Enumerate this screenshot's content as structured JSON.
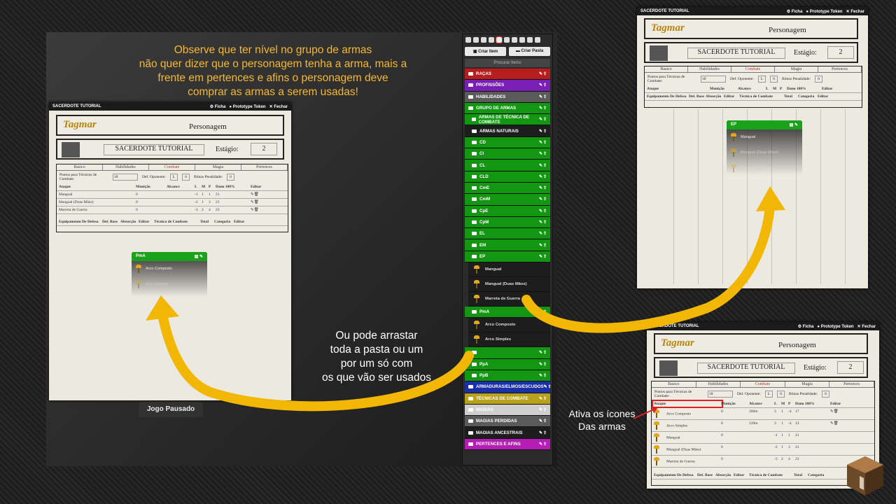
{
  "top_caption": [
    "Observe que ter nível no grupo de armas",
    "não quer dizer que o personagem tenha a arma, mais a",
    "frente em pertences e afins o personagem deve",
    "comprar as armas a serem usadas!"
  ],
  "mid_caption": [
    "Ou pode arrastar",
    "toda a pasta ou um",
    "por um só com",
    "os que vão ser usados"
  ],
  "right_caption": [
    "Ativa os ícones",
    "Das armas"
  ],
  "paused_label": "Jogo Pausado",
  "sheet": {
    "window_title": "SACERDOTE TUTORIAL",
    "ficha": "Ficha",
    "prototype": "Prototype Token",
    "fechar": "Fechar",
    "logo": "Tagmar",
    "title": "Personagem",
    "char_name": "SACERDOTE TUTORIAL",
    "estagio_label": "Estágio:",
    "estagio_value": "2",
    "tabs": [
      "Basico",
      "Habilidades",
      "Combate",
      "Magia",
      "Pertences"
    ],
    "pontos_label": "Pontos para Técnicas de Combate:",
    "pontos_value": "18",
    "def_label": "Def. Oponente:",
    "def_sel": "L",
    "def_val": "0",
    "bonus_label": "Bônus Penalidade:",
    "bonus_val": "0",
    "headers": [
      "Ataque",
      "Munição",
      "Alcance",
      "L",
      "M",
      "P",
      "Dano 100%",
      "Editar"
    ],
    "bottom_headers": [
      "Equipamento De Defesa",
      "Def. Base",
      "Absorção",
      "Editar",
      "Técnica de Combate",
      "Total",
      "Categoria",
      "Editar"
    ],
    "left_rows": [
      [
        "Mangual",
        "0",
        "",
        "-1",
        "1",
        "1",
        "21"
      ],
      [
        "Mangual (Duas Mãos)",
        "0",
        "",
        "-2",
        "1",
        "3",
        "21"
      ],
      [
        "Marreta de Guerra",
        "0",
        "",
        "-3",
        "2",
        "4",
        "23"
      ]
    ],
    "right_rows": [
      [
        "Arco Composto",
        "0",
        "200m",
        "3",
        "1",
        "-4",
        "17"
      ],
      [
        "Arco Simples",
        "0",
        "120m",
        "3",
        "1",
        "-4",
        "13"
      ],
      [
        "Mangual",
        "0",
        "",
        "-1",
        "1",
        "1",
        "21"
      ],
      [
        "Mangual (Duas Mãos)",
        "0",
        "",
        "-2",
        "1",
        "3",
        "21"
      ],
      [
        "Marreta de Guerra",
        "0",
        "",
        "-3",
        "2",
        "4",
        "23"
      ]
    ]
  },
  "drag_left": {
    "header": "PmA",
    "items": [
      "Arco Composto",
      "Arco Simples"
    ]
  },
  "drag_top": {
    "header": "EP",
    "items": [
      "Mangual",
      "Mangual (Duas Mãos)",
      "Marreta de Guerra"
    ]
  },
  "sidebar": {
    "criar_item": "Criar Item",
    "criar_pasta": "Criar Pasta",
    "search": "Procurar Items",
    "folders": [
      {
        "label": "RAÇAS",
        "color": "#b81d1d"
      },
      {
        "label": "PROFISSÕES",
        "color": "#7a1fb5"
      },
      {
        "label": "HABILIDADES",
        "color": "#5a5a5a"
      },
      {
        "label": "GRUPO DE ARMAS",
        "color": "#139713"
      },
      {
        "label": "ARMAS DE TÉCNICA DE COMBATE",
        "color": "#139713",
        "sub": true
      },
      {
        "label": "ARMAS NATURAIS",
        "color": "#1d1d1d",
        "sub": true
      },
      {
        "label": "CD",
        "color": "#139713",
        "sub": true
      },
      {
        "label": "CI",
        "color": "#139713",
        "sub": true
      },
      {
        "label": "CL",
        "color": "#139713",
        "sub": true
      },
      {
        "label": "CLD",
        "color": "#139713",
        "sub": true
      },
      {
        "label": "CmE",
        "color": "#139713",
        "sub": true
      },
      {
        "label": "CmM",
        "color": "#139713",
        "sub": true
      },
      {
        "label": "CpE",
        "color": "#139713",
        "sub": true
      },
      {
        "label": "CpM",
        "color": "#139713",
        "sub": true
      },
      {
        "label": "EL",
        "color": "#139713",
        "sub": true
      },
      {
        "label": "EM",
        "color": "#139713",
        "sub": true
      },
      {
        "label": "EP",
        "color": "#139713",
        "sub": true,
        "items": [
          "Mangual",
          "Mangual (Duas Mãos)",
          "Marreta de Guerra"
        ]
      },
      {
        "label": "PmA",
        "color": "#139713",
        "sub": true,
        "items": [
          "Arco Composto",
          "Arco Simples"
        ]
      },
      {
        "label": "",
        "color": "#139713",
        "sub": true
      },
      {
        "label": "PpA",
        "color": "#139713",
        "sub": true
      },
      {
        "label": "PpB",
        "color": "#139713",
        "sub": true
      },
      {
        "label": "ARMADURAS/ELMOS/ESCUDOS",
        "color": "#1a2fa8"
      },
      {
        "label": "TÉCNICAS DE COMBATE",
        "color": "#b8a21d"
      },
      {
        "label": "MAGIAS",
        "color": "#cfcfcf"
      },
      {
        "label": "MAGIAS PERDIDAS",
        "color": "#5a5a5a"
      },
      {
        "label": "MAGIAS ANCESTRAIS",
        "color": "#1d1d1d"
      },
      {
        "label": "PERTENCES E AFINS",
        "color": "#b51db5"
      }
    ]
  }
}
